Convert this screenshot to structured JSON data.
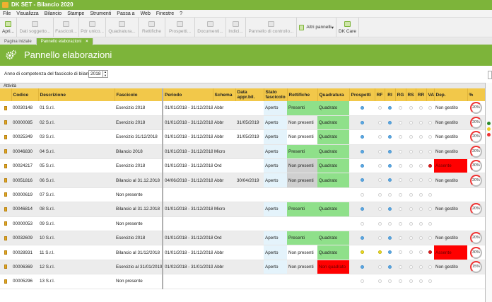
{
  "window": {
    "title": "DK SET - Bilancio 2020"
  },
  "menu": [
    "File",
    "Visualizza",
    "Bilancio",
    "Stampe",
    "Strumenti",
    "Passa a",
    "Web",
    "Finestre",
    "?"
  ],
  "toolbar": [
    {
      "label": "Apri...",
      "enabled": true,
      "w": 24,
      "icon": "folder-open-icon"
    },
    {
      "label": "Dati soggetto...",
      "enabled": false,
      "w": 52,
      "icon": "user-data-icon"
    },
    {
      "label": "Fascicoli...",
      "enabled": false,
      "w": 36,
      "icon": "folders-icon"
    },
    {
      "label": "Pdr unico...",
      "enabled": false,
      "w": 38,
      "icon": "pdr-icon"
    },
    {
      "label": "Quadratura...",
      "enabled": false,
      "w": 46,
      "icon": "balance-icon"
    },
    {
      "label": "Rettifiche",
      "enabled": false,
      "w": 38,
      "icon": "adjust-icon"
    },
    {
      "label": "Prospetti...",
      "enabled": false,
      "w": 42,
      "icon": "prospects-icon"
    },
    {
      "label": "Documenti...",
      "enabled": false,
      "w": 44,
      "icon": "documents-icon"
    },
    {
      "label": "Indici...",
      "enabled": false,
      "w": 28,
      "icon": "indices-icon"
    },
    {
      "label": "Pannello di controllo...",
      "enabled": false,
      "w": 72,
      "icon": "control-panel-icon"
    },
    {
      "label": "Altri pannelli",
      "enabled": true,
      "w": 56,
      "icon": "panels-icon",
      "row": true
    },
    {
      "label": "DK Care",
      "enabled": true,
      "w": 32,
      "icon": "dk-care-icon"
    }
  ],
  "tabs": [
    {
      "label": "Pagina iniziale",
      "active": false
    },
    {
      "label": "Pannello elaborazioni",
      "active": true,
      "close": "×"
    }
  ],
  "header": {
    "title": "Pannello elaborazioni"
  },
  "year": {
    "label": "Anno di competenza del fascicolo di bilancio:",
    "value": "2018"
  },
  "section_label": "Attività",
  "columns": [
    "Codice",
    "Descrizione",
    "Fascicolo",
    "Periodo",
    "Schema",
    "Data appr.bil.",
    "Stato fascicolo",
    "Rettifiche",
    "Quadratura",
    "Prospetti",
    "RF",
    "RI",
    "RG",
    "RS",
    "RR",
    "VA",
    "Dep.",
    "%"
  ],
  "rows": [
    {
      "codice": "00030148",
      "desc": "01 S.r.l.",
      "fasc": "Esercizio 2018",
      "periodo": "01/01/2018 - 31/12/2018",
      "schema": "Abbr",
      "data": "",
      "stato": "Aperto",
      "rett": "Presenti",
      "rettc": "green",
      "quad": "Quadrato",
      "quadc": "green",
      "dots": [
        "b",
        "g",
        "b",
        "g",
        "g",
        "g",
        "g"
      ],
      "dep": "Non gestito",
      "depc": "",
      "pct": "20%"
    },
    {
      "codice": "00000085",
      "desc": "02 S.r.l.",
      "fasc": "Esercizio 2018",
      "periodo": "01/01/2018 - 31/12/2018",
      "schema": "Abbr",
      "data": "31/05/2019",
      "stato": "Aperto",
      "rett": "Non presenti",
      "rettc": "",
      "quad": "Quadrato",
      "quadc": "green",
      "dots": [
        "b",
        "g",
        "b",
        "g",
        "g",
        "g",
        "g"
      ],
      "dep": "Non gestito",
      "depc": "",
      "pct": "20%"
    },
    {
      "codice": "00025349",
      "desc": "03 S.r.l.",
      "fasc": "Esercizio 31/12/2018",
      "periodo": "01/01/2018 - 31/12/2018",
      "schema": "Abbr",
      "data": "31/05/2019",
      "stato": "Aperto",
      "rett": "Non presenti",
      "rettc": "",
      "quad": "Quadrato",
      "quadc": "green",
      "dots": [
        "b",
        "g",
        "b",
        "g",
        "g",
        "g",
        "g"
      ],
      "dep": "Non gestito",
      "depc": "",
      "pct": "20%"
    },
    {
      "codice": "00046830",
      "desc": "04 S.r.l.",
      "fasc": "Bilancio 2018",
      "periodo": "01/01/2018 - 31/12/2018",
      "schema": "Micro",
      "data": "",
      "stato": "Aperto",
      "rett": "Presenti",
      "rettc": "green",
      "quad": "Quadrato",
      "quadc": "green",
      "dots": [
        "b",
        "g",
        "b",
        "g",
        "g",
        "g",
        "g"
      ],
      "dep": "Non gestito",
      "depc": "",
      "pct": "20%"
    },
    {
      "codice": "00024217",
      "desc": "05 S.r.l.",
      "fasc": "Esercizio 2018",
      "periodo": "01/01/2018 - 31/12/2018",
      "schema": "Ord",
      "data": "",
      "stato": "Aperto",
      "rett": "Non presenti",
      "rettc": "greyc",
      "quad": "Quadrato",
      "quadc": "green",
      "dots": [
        "b",
        "g",
        "b",
        "g",
        "g",
        "g",
        "r"
      ],
      "dep": "Assente",
      "depc": "red",
      "pct": "30%"
    },
    {
      "codice": "00051816",
      "desc": "06 S.r.l.",
      "fasc": "Bilancio al 31.12.2018",
      "periodo": "04/06/2018 - 31/12/2018",
      "schema": "Abbr",
      "data": "30/04/2019",
      "stato": "Aperto",
      "rett": "Non presenti",
      "rettc": "greyc",
      "quad": "Quadrato",
      "quadc": "green",
      "dots": [
        "b",
        "g",
        "b",
        "g",
        "g",
        "g",
        "g"
      ],
      "dep": "Non gestito",
      "depc": "",
      "pct": "20%"
    },
    {
      "codice": "00000619",
      "desc": "07 S.r.l.",
      "fasc": "Non presente",
      "periodo": "",
      "schema": "",
      "data": "",
      "stato": "",
      "rett": "",
      "rettc": "",
      "quad": "",
      "quadc": "",
      "dots": [
        "g",
        "g",
        "g",
        "g",
        "g",
        "g",
        "g"
      ],
      "dep": "",
      "depc": "",
      "pct": ""
    },
    {
      "codice": "00046814",
      "desc": "08 S.r.l.",
      "fasc": "Bilancio al 31.12.2018",
      "periodo": "01/01/2018 - 31/12/2018",
      "schema": "Micro",
      "data": "",
      "stato": "Aperto",
      "rett": "Presenti",
      "rettc": "green",
      "quad": "Quadrato",
      "quadc": "green",
      "dots": [
        "b",
        "g",
        "b",
        "g",
        "g",
        "g",
        "g"
      ],
      "dep": "Non gestito",
      "depc": "",
      "pct": "20%"
    },
    {
      "codice": "00000053",
      "desc": "09 S.r.l.",
      "fasc": "Non presente",
      "periodo": "",
      "schema": "",
      "data": "",
      "stato": "",
      "rett": "",
      "rettc": "",
      "quad": "",
      "quadc": "",
      "dots": [
        "g",
        "g",
        "g",
        "g",
        "g",
        "g",
        "g"
      ],
      "dep": "",
      "depc": "",
      "pct": ""
    },
    {
      "codice": "00032609",
      "desc": "10 S.r.l.",
      "fasc": "Esercizio 2018",
      "periodo": "01/01/2018 - 31/12/2018",
      "schema": "Ord",
      "data": "",
      "stato": "Aperto",
      "rett": "Presenti",
      "rettc": "green",
      "quad": "Quadrato",
      "quadc": "green",
      "dots": [
        "b",
        "g",
        "b",
        "g",
        "g",
        "g",
        "g"
      ],
      "dep": "Non gestito",
      "depc": "",
      "pct": "20%"
    },
    {
      "codice": "00028931",
      "desc": "11 S.r.l.",
      "fasc": "Bilancio al 31/12/2018",
      "periodo": "01/01/2018 - 31/12/2018",
      "schema": "Abbr",
      "data": "",
      "stato": "Aperto",
      "rett": "Non presenti",
      "rettc": "",
      "quad": "Quadrato",
      "quadc": "green",
      "dots": [
        "y",
        "y",
        "b",
        "g",
        "g",
        "g",
        "r"
      ],
      "dep": "Assente",
      "depc": "red",
      "pct": "30%"
    },
    {
      "codice": "00006369",
      "desc": "12 S.r.l.",
      "fasc": "Esercizio al 31/01/2019",
      "periodo": "01/02/2018 - 31/01/2019",
      "schema": "Abbr",
      "data": "",
      "stato": "Aperto",
      "rett": "Non presenti",
      "rettc": "",
      "quad": "Non quadrato",
      "quadc": "red",
      "dots": [
        "b",
        "g",
        "b",
        "g",
        "g",
        "g",
        "g"
      ],
      "dep": "Non gestito",
      "depc": "",
      "pct": "15%"
    },
    {
      "codice": "00005296",
      "desc": "13 S.r.l.",
      "fasc": "Non presente",
      "periodo": "",
      "schema": "",
      "data": "",
      "stato": "",
      "rett": "",
      "rettc": "",
      "quad": "",
      "quadc": "",
      "dots": [
        "g",
        "g",
        "g",
        "g",
        "g",
        "g",
        "g"
      ],
      "dep": "",
      "depc": "",
      "pct": ""
    }
  ]
}
